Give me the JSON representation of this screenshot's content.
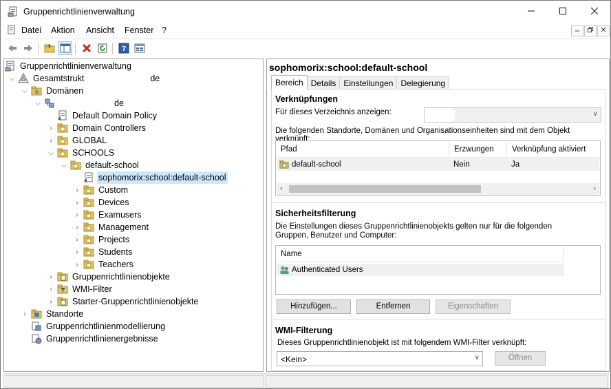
{
  "window": {
    "title": "Gruppenrichtlinienverwaltung"
  },
  "menu": [
    "Datei",
    "Aktion",
    "Ansicht",
    "Fenster",
    "?"
  ],
  "toolbar": [
    "back-icon",
    "forward-icon",
    "up-folder-icon",
    "show-hide-tree-icon",
    "delete-icon",
    "refresh-icon",
    "help-icon",
    "properties-icon"
  ],
  "tree": {
    "root": "Gruppenrichtlinienverwaltung",
    "forest": "Gesamtstrukt",
    "forest_suffix": "de",
    "domains": "Domänen",
    "domain_suffix": "de",
    "default_domain_policy": "Default Domain Policy",
    "domain_controllers": "Domain Controllers",
    "global": "GLOBAL",
    "schools": "SCHOOLS",
    "default_school": "default-school",
    "gpo_link": "sophomorix:school:default-school",
    "school_children": [
      "Custom",
      "Devices",
      "Examusers",
      "Management",
      "Projects",
      "Students",
      "Teachers"
    ],
    "gpo_objects": "Gruppenrichtlinienobjekte",
    "wmi_filter": "WMI-Filter",
    "starter_gpo": "Starter-Gruppenrichtlinienobjekte",
    "sites": "Standorte",
    "modeling": "Gruppenrichtlinienmodellierung",
    "results": "Gruppenrichtlinienergebnisse"
  },
  "details": {
    "title": "sophomorix:school:default-school",
    "tabs": [
      "Bereich",
      "Details",
      "Einstellungen",
      "Delegierung"
    ],
    "links": {
      "heading": "Verknüpfungen",
      "show_for_label": "Für dieses Verzeichnis anzeigen:",
      "description": "Die folgenden Standorte, Domänen und Organisationseinheiten sind mit dem Objekt verknüpft:",
      "columns": [
        "Pfad",
        "Erzwungen",
        "Verknüpfung aktiviert"
      ],
      "rows": [
        {
          "path": "default-school",
          "enforced": "Nein",
          "enabled": "Ja"
        }
      ]
    },
    "security": {
      "heading": "Sicherheitsfilterung",
      "description_line1": "Die Einstellungen dieses Gruppenrichtlinienobjekts gelten nur für die folgenden",
      "description_line2": "Gruppen, Benutzer und Computer:",
      "column": "Name",
      "rows": [
        "Authenticated Users"
      ],
      "buttons": {
        "add": "Hinzufügen...",
        "remove": "Entfernen",
        "properties": "Eigenschaften"
      }
    },
    "wmi": {
      "heading": "WMI-Filterung",
      "description": "Dieses Gruppenrichtlinienobjekt ist mit folgendem WMI-Filter verknüpft:",
      "selected": "<Kein>",
      "open_button": "Öffnen"
    }
  }
}
